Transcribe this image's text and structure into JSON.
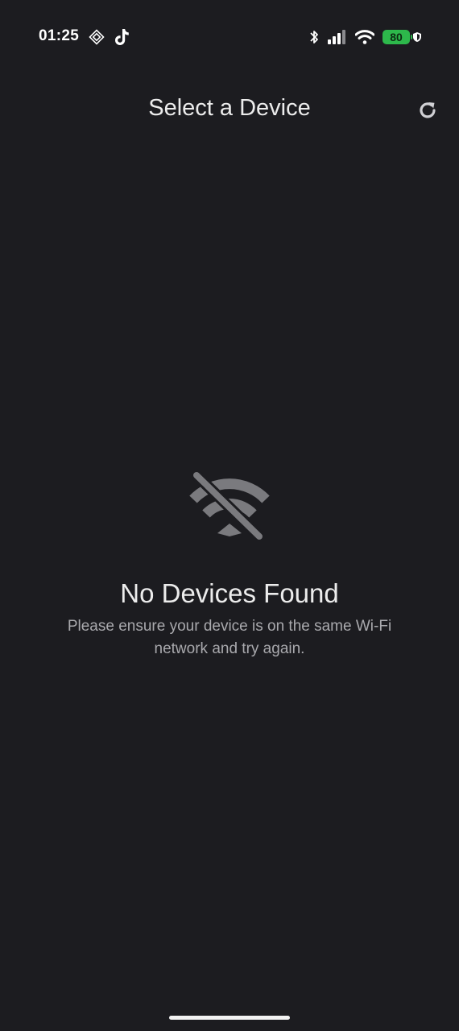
{
  "status_bar": {
    "time": "01:25",
    "battery_level": "80",
    "battery_color": "#2db84b",
    "icons": [
      "diamond-app-icon",
      "tiktok-icon",
      "bluetooth-icon",
      "signal-icon",
      "wifi-icon",
      "battery-icon",
      "shield-icon"
    ]
  },
  "header": {
    "title": "Select a Device",
    "refresh_icon": "refresh-icon"
  },
  "empty_state": {
    "icon": "wifi-off-icon",
    "title": "No Devices Found",
    "message": "Please ensure your device is on the same Wi-Fi network and try again."
  },
  "colors": {
    "background": "#1c1c20",
    "text_primary": "#ececec",
    "text_secondary": "#a9a9ad",
    "icon_muted": "#7a7a7e"
  }
}
